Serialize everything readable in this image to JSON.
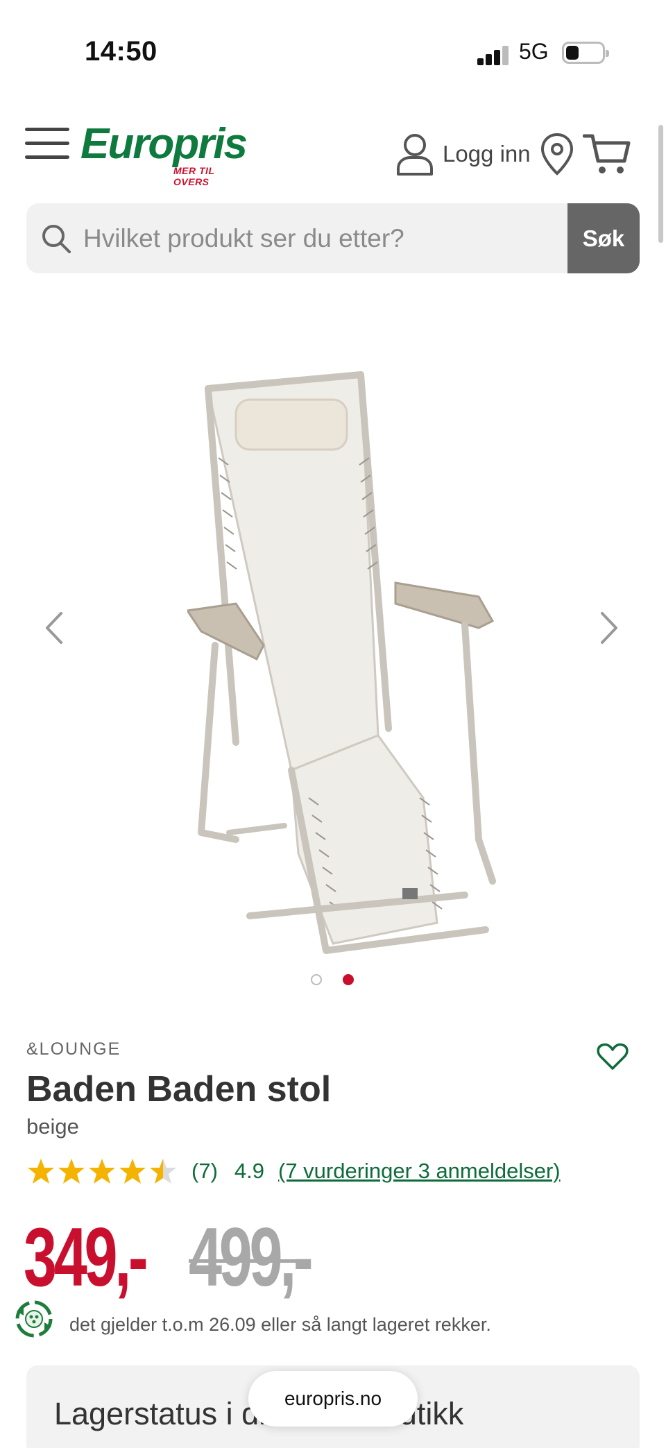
{
  "status_bar": {
    "time": "14:50",
    "network": "5G"
  },
  "header": {
    "logo_word": "Europris",
    "logo_tagline": "MER TIL OVERS",
    "login_label": "Logg inn"
  },
  "search": {
    "placeholder": "Hvilket produkt ser du etter?",
    "button_label": "Søk"
  },
  "gallery": {
    "image_count": 2,
    "active_index": 2
  },
  "product": {
    "brand": "&LOUNGE",
    "title": "Baden Baden stol",
    "variant": "beige",
    "rating_count": "(7)",
    "rating_score": "4.9",
    "rating_link": "(7 vurderinger 3 anmeldelser)",
    "rating_value": 4.5,
    "price": "349,-",
    "old_price": "499,-",
    "offer_text": "det gjelder t.o.m 26.09 eller så langt lageret rekker."
  },
  "stock": {
    "title": "Lagerstatus i din lokale butikk"
  },
  "browser": {
    "url": "europris.no"
  },
  "colors": {
    "brand_green": "#0e7a3e",
    "brand_red": "#c8102e",
    "star": "#f5b301"
  }
}
